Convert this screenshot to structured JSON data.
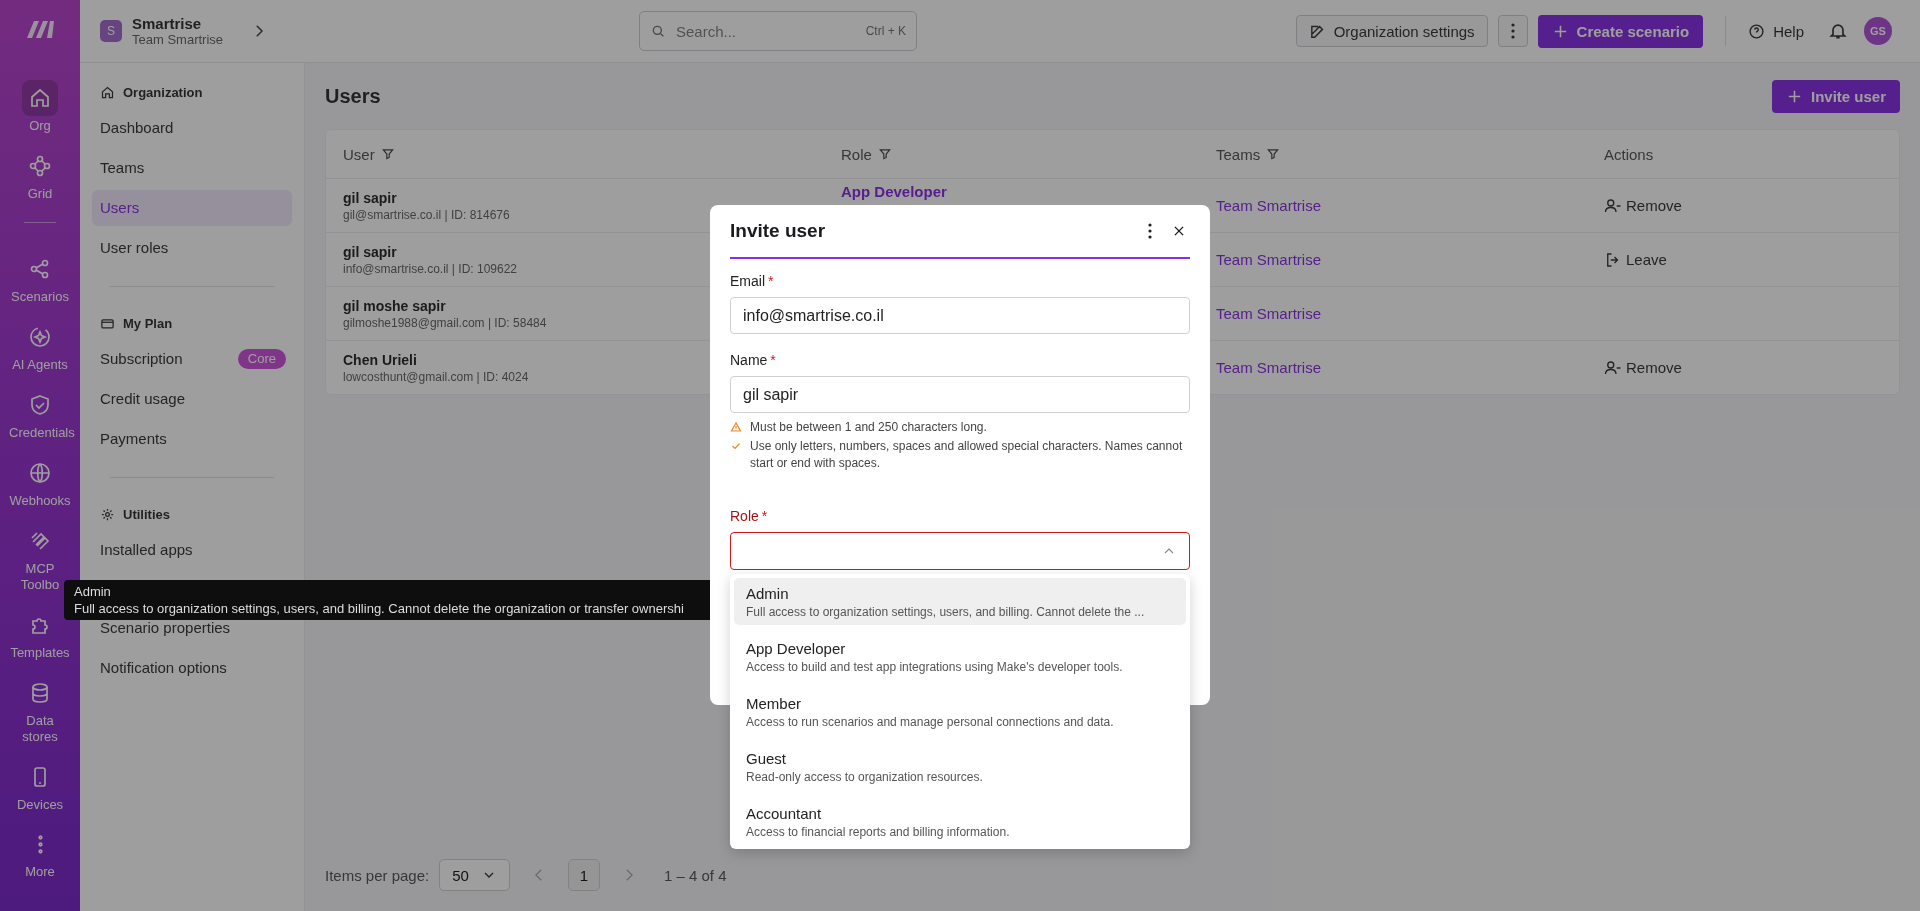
{
  "rail": {
    "items": [
      {
        "label": "Org",
        "selected": true
      },
      {
        "label": "Grid",
        "selected": false
      },
      {
        "label": "Scenarios",
        "selected": false
      },
      {
        "label": "AI Agents",
        "selected": false
      },
      {
        "label": "Credentials",
        "selected": false
      },
      {
        "label": "Webhooks",
        "selected": false
      },
      {
        "label": "MCP Toolbo",
        "selected": false
      },
      {
        "label": "Templates",
        "selected": false
      },
      {
        "label": "Data stores",
        "selected": false
      },
      {
        "label": "Devices",
        "selected": false
      },
      {
        "label": "More",
        "selected": false
      }
    ]
  },
  "org_switcher": {
    "initial": "S",
    "name": "Smartrise",
    "team": "Team Smartrise"
  },
  "nav": {
    "sections": [
      {
        "title": "Organization",
        "items": [
          {
            "label": "Dashboard",
            "selected": false
          },
          {
            "label": "Teams",
            "selected": false
          },
          {
            "label": "Users",
            "selected": true
          },
          {
            "label": "User roles",
            "selected": false
          }
        ]
      },
      {
        "title": "My Plan",
        "items": [
          {
            "label": "Subscription",
            "selected": false,
            "badge": "Core"
          },
          {
            "label": "Credit usage",
            "selected": false
          },
          {
            "label": "Payments",
            "selected": false
          }
        ]
      },
      {
        "title": "Utilities",
        "items": [
          {
            "label": "Installed apps",
            "selected": false
          },
          {
            "label": "Scenario properties",
            "selected": false
          },
          {
            "label": "Notification options",
            "selected": false
          }
        ]
      }
    ]
  },
  "topbar": {
    "search": {
      "placeholder": "Search...",
      "shortcut": "Ctrl + K"
    },
    "org_settings": "Organization settings",
    "create": "Create scenario",
    "help": "Help",
    "avatar": "GS"
  },
  "page": {
    "title": "Users",
    "invite": "Invite user"
  },
  "table": {
    "columns": [
      {
        "label": "User",
        "filter": true
      },
      {
        "label": "Role",
        "filter": true
      },
      {
        "label": "Teams",
        "filter": true
      },
      {
        "label": "Actions",
        "filter": false
      }
    ],
    "rows": [
      {
        "name": "gil sapir",
        "detail": "gil@smartrise.co.il | ID: 814676",
        "role": "App Developer",
        "team": "Team Smartrise",
        "action": {
          "kind": "remove",
          "label": "Remove"
        }
      },
      {
        "name": "gil sapir",
        "detail": "info@smartrise.co.il | ID: 109622",
        "team": "Team Smartrise",
        "action": {
          "kind": "leave",
          "label": "Leave"
        }
      },
      {
        "name": "gil moshe sapir",
        "detail": "gilmoshe1988@gmail.com | ID: 58484",
        "team": "Team Smartrise"
      },
      {
        "name": "Chen Urieli",
        "detail": "lowcosthunt@gmail.com | ID: 4024",
        "team": "Team Smartrise",
        "action": {
          "kind": "remove",
          "label": "Remove"
        }
      }
    ]
  },
  "pagination": {
    "label": "Items per page:",
    "per_page": "50",
    "page": "1",
    "range": "1 – 4 of 4"
  },
  "tooltip": {
    "title": "Admin",
    "text": "Full access to organization settings, users, and billing. Cannot delete the organization or transfer ownershi"
  },
  "modal": {
    "title": "Invite user",
    "fields": [
      {
        "label": "Email",
        "required_mark": "*",
        "value": "info@smartrise.co.il",
        "error": false
      },
      {
        "label": "Name",
        "required_mark": "*",
        "value": "gil sapir",
        "error": false,
        "hints": [
          {
            "kind": "warning",
            "text": "Must be between 1 and 250 characters long."
          },
          {
            "kind": "valid",
            "text": "Use only letters, numbers, spaces and allowed special characters. Names cannot start or end with spaces."
          }
        ]
      },
      {
        "label": "Role",
        "required_mark": "*",
        "kind": "select",
        "error": true,
        "expanded": true,
        "options": [
          {
            "title": "Admin",
            "description": "Full access to organization settings, users, and billing. Cannot delete the ...",
            "highlighted": true
          },
          {
            "title": "App Developer",
            "description": "Access to build and test app integrations using Make's developer tools.",
            "highlighted": false
          },
          {
            "title": "Member",
            "description": "Access to run scenarios and manage personal connections and data.",
            "highlighted": false
          },
          {
            "title": "Guest",
            "description": "Read-only access to organization resources.",
            "highlighted": false
          },
          {
            "title": "Accountant",
            "description": "Access to financial reports and billing information.",
            "highlighted": false
          }
        ]
      }
    ]
  }
}
